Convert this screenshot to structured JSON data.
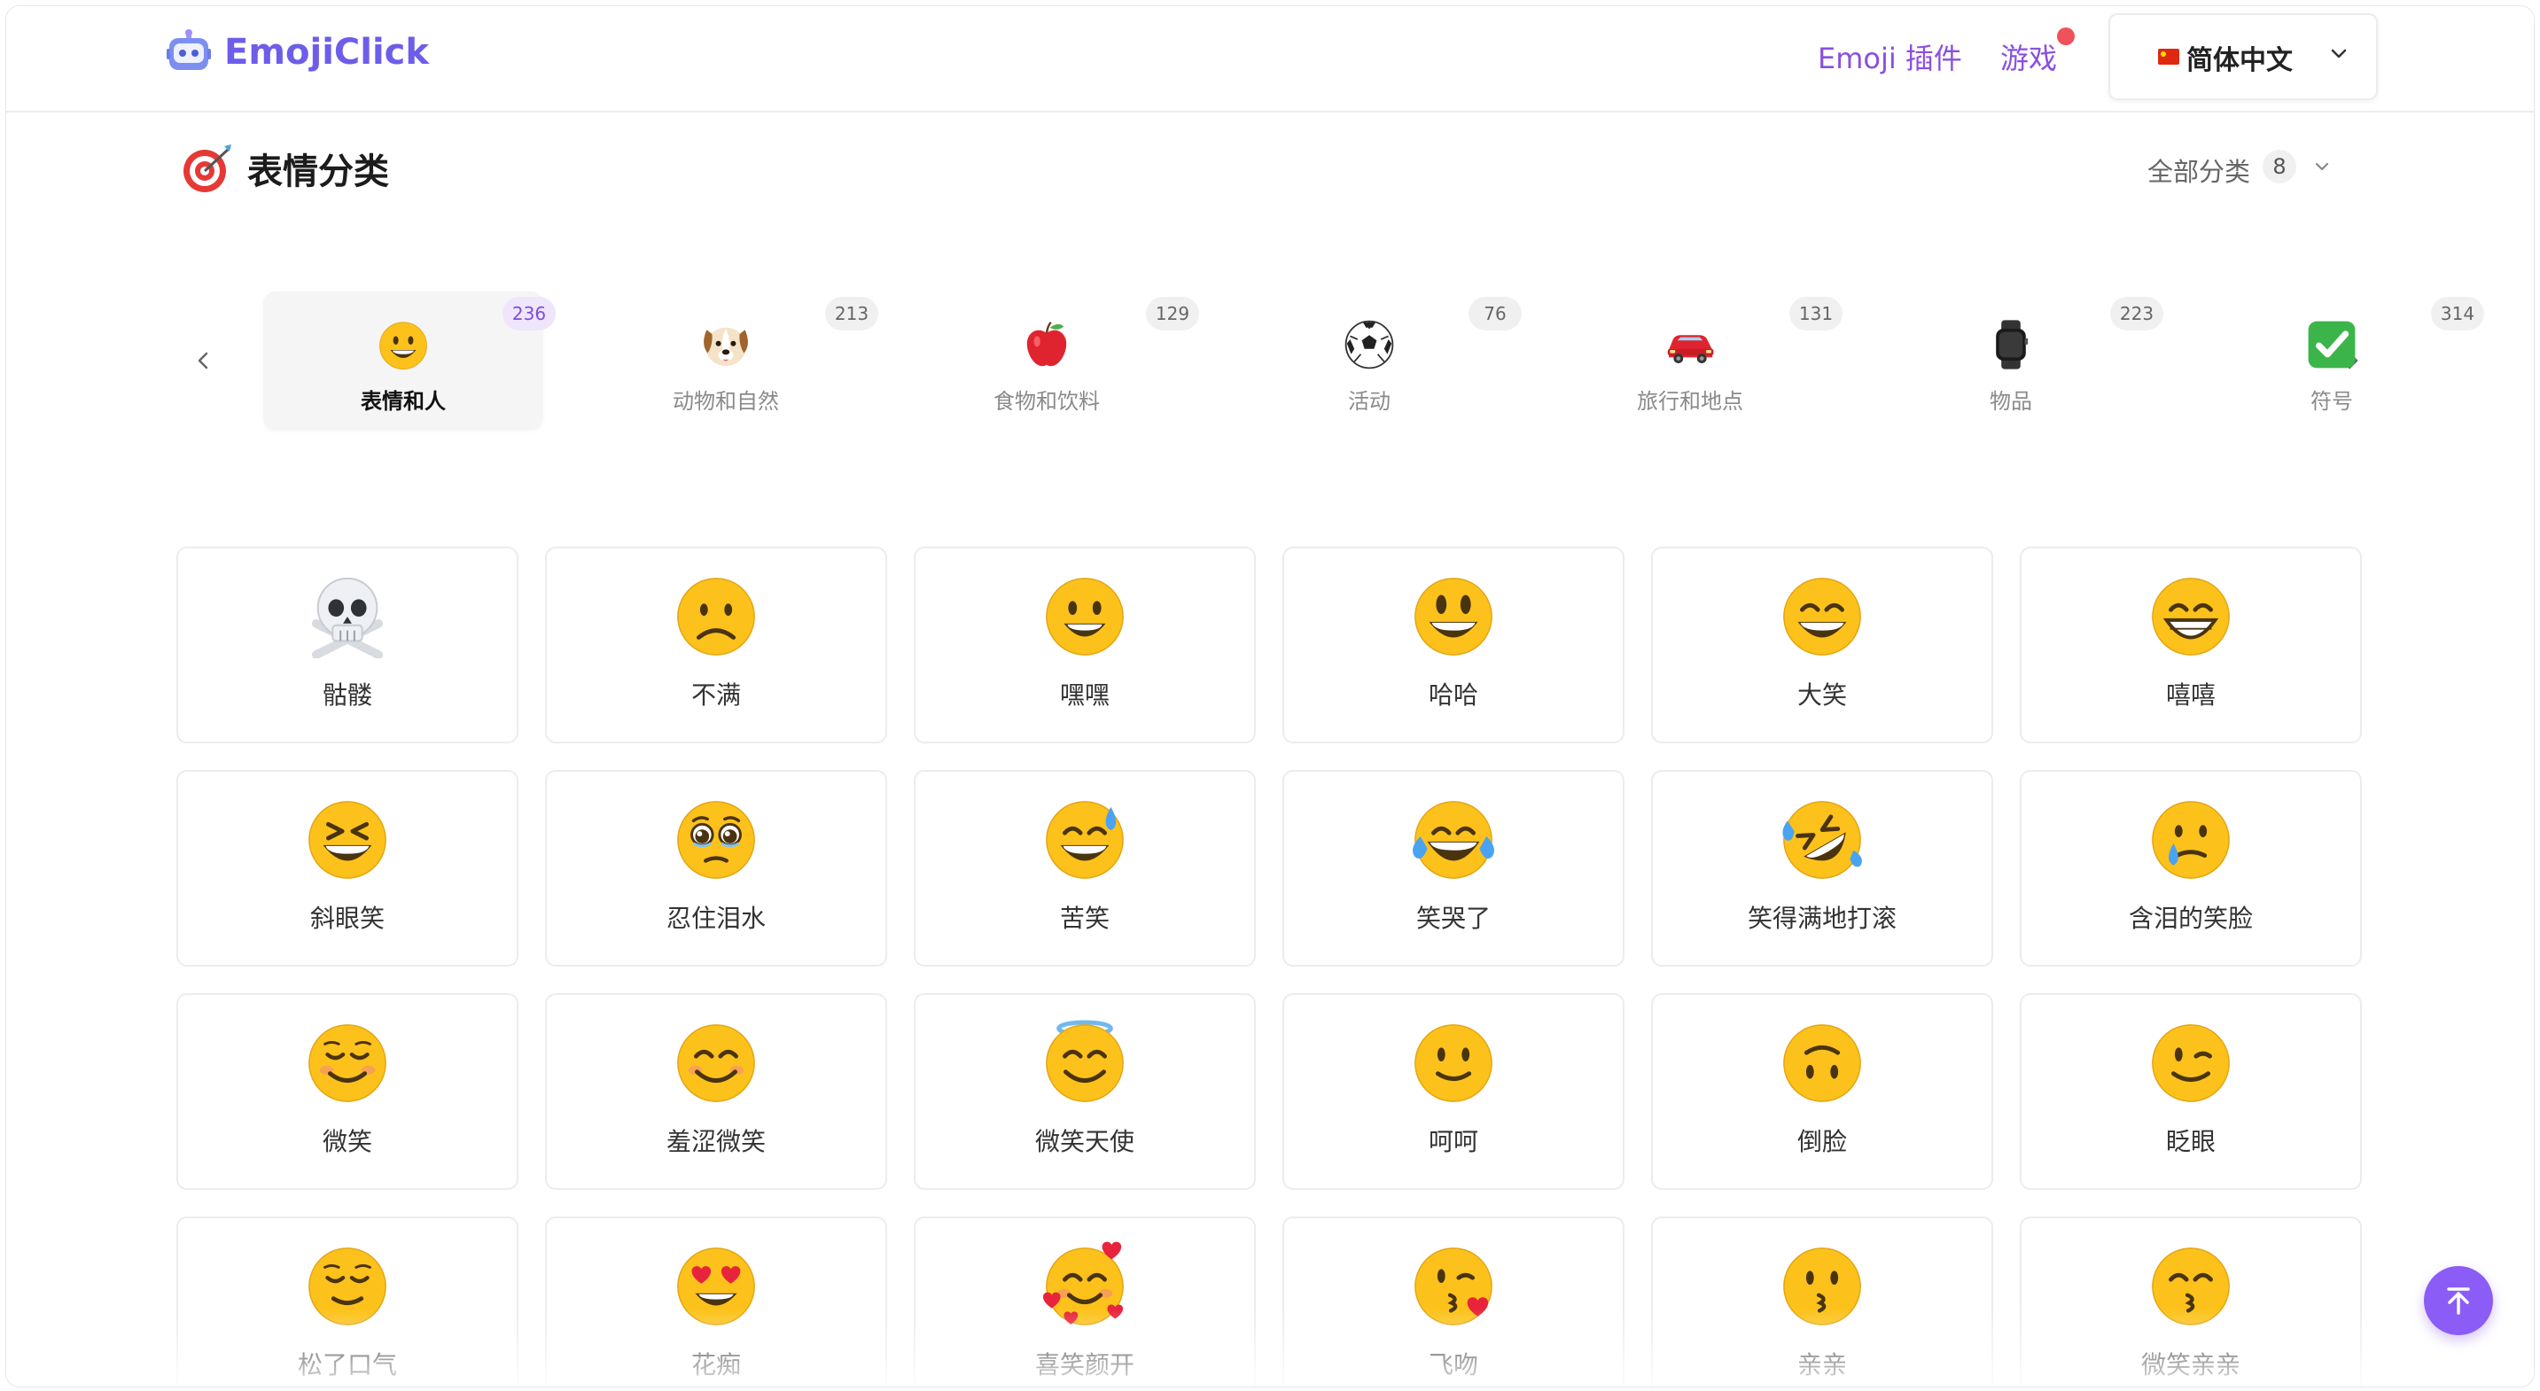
{
  "header": {
    "brand": "EmojiClick",
    "nav": {
      "plugin": "Emoji 插件",
      "games": "游戏"
    },
    "language": "简体中文"
  },
  "section": {
    "title": "表情分类",
    "all_categories_label": "全部分类",
    "all_categories_count": "8"
  },
  "categories": [
    {
      "label": "表情和人",
      "count": "236",
      "icon": "grinning-face-icon",
      "active": true
    },
    {
      "label": "动物和自然",
      "count": "213",
      "icon": "dog-face-icon",
      "active": false
    },
    {
      "label": "食物和饮料",
      "count": "129",
      "icon": "red-apple-icon",
      "active": false
    },
    {
      "label": "活动",
      "count": "76",
      "icon": "soccer-ball-icon",
      "active": false
    },
    {
      "label": "旅行和地点",
      "count": "131",
      "icon": "red-car-icon",
      "active": false
    },
    {
      "label": "物品",
      "count": "223",
      "icon": "watch-icon",
      "active": false
    },
    {
      "label": "符号",
      "count": "314",
      "icon": "check-mark-icon",
      "active": false
    }
  ],
  "emojis": [
    {
      "label": "骷髅",
      "icon": "skull-crossbones-icon"
    },
    {
      "label": "不满",
      "icon": "frowning-face-icon"
    },
    {
      "label": "嘿嘿",
      "icon": "grinning-face-icon"
    },
    {
      "label": "哈哈",
      "icon": "grinning-big-eyes-icon"
    },
    {
      "label": "大笑",
      "icon": "grinning-smiling-eyes-icon"
    },
    {
      "label": "嘻嘻",
      "icon": "beaming-face-icon"
    },
    {
      "label": "斜眼笑",
      "icon": "squinting-face-icon"
    },
    {
      "label": "忍住泪水",
      "icon": "holding-back-tears-icon"
    },
    {
      "label": "苦笑",
      "icon": "grinning-sweat-icon"
    },
    {
      "label": "笑哭了",
      "icon": "tears-of-joy-icon"
    },
    {
      "label": "笑得满地打滚",
      "icon": "rolling-laughing-icon"
    },
    {
      "label": "含泪的笑脸",
      "icon": "smiling-tear-icon"
    },
    {
      "label": "微笑",
      "icon": "smiling-face-icon"
    },
    {
      "label": "羞涩微笑",
      "icon": "blush-face-icon"
    },
    {
      "label": "微笑天使",
      "icon": "halo-face-icon"
    },
    {
      "label": "呵呵",
      "icon": "slight-smile-icon"
    },
    {
      "label": "倒脸",
      "icon": "upside-down-face-icon"
    },
    {
      "label": "眨眼",
      "icon": "winking-face-icon"
    },
    {
      "label": "松了口气",
      "icon": "relieved-face-icon"
    },
    {
      "label": "花痴",
      "icon": "heart-eyes-icon"
    },
    {
      "label": "喜笑颜开",
      "icon": "smiling-hearts-icon"
    },
    {
      "label": "飞吻",
      "icon": "blowing-kiss-icon"
    },
    {
      "label": "亲亲",
      "icon": "kissing-face-icon"
    },
    {
      "label": "微笑亲亲",
      "icon": "kissing-smiling-eyes-icon"
    }
  ],
  "colors": {
    "accent": "#8b5cf6",
    "brand_text": "#6d5dea",
    "nav_link": "#8a4fe0",
    "emoji_yellow": "#fcc21b",
    "notification_dot": "#f0525b"
  }
}
